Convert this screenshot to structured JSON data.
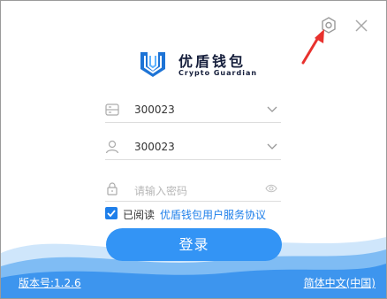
{
  "brand": {
    "name_cn": "优盾钱包",
    "name_en": "Crypto Guardian",
    "colors": {
      "logo_blue": "#1e74d6",
      "text_dark": "#151e3b"
    }
  },
  "window_controls": {
    "settings_icon": "gear-icon",
    "close_icon": "close-icon"
  },
  "form": {
    "server_value": "300023",
    "server_icon": "server-icon",
    "account_value": "300023",
    "account_icon": "user-icon",
    "password_placeholder": "请输入密码",
    "password_icon": "lock-icon",
    "eye_icon": "eye-icon"
  },
  "agreement": {
    "checked": true,
    "prefix": "已阅读",
    "link": "优盾钱包用户服务协议"
  },
  "login_button": "登录",
  "footer": {
    "version": "版本号:1.2.6",
    "language": "简体中文(中国)"
  },
  "colors": {
    "accent": "#3394f5",
    "link": "#1e7fea",
    "annotation_arrow": "#e8312d"
  }
}
